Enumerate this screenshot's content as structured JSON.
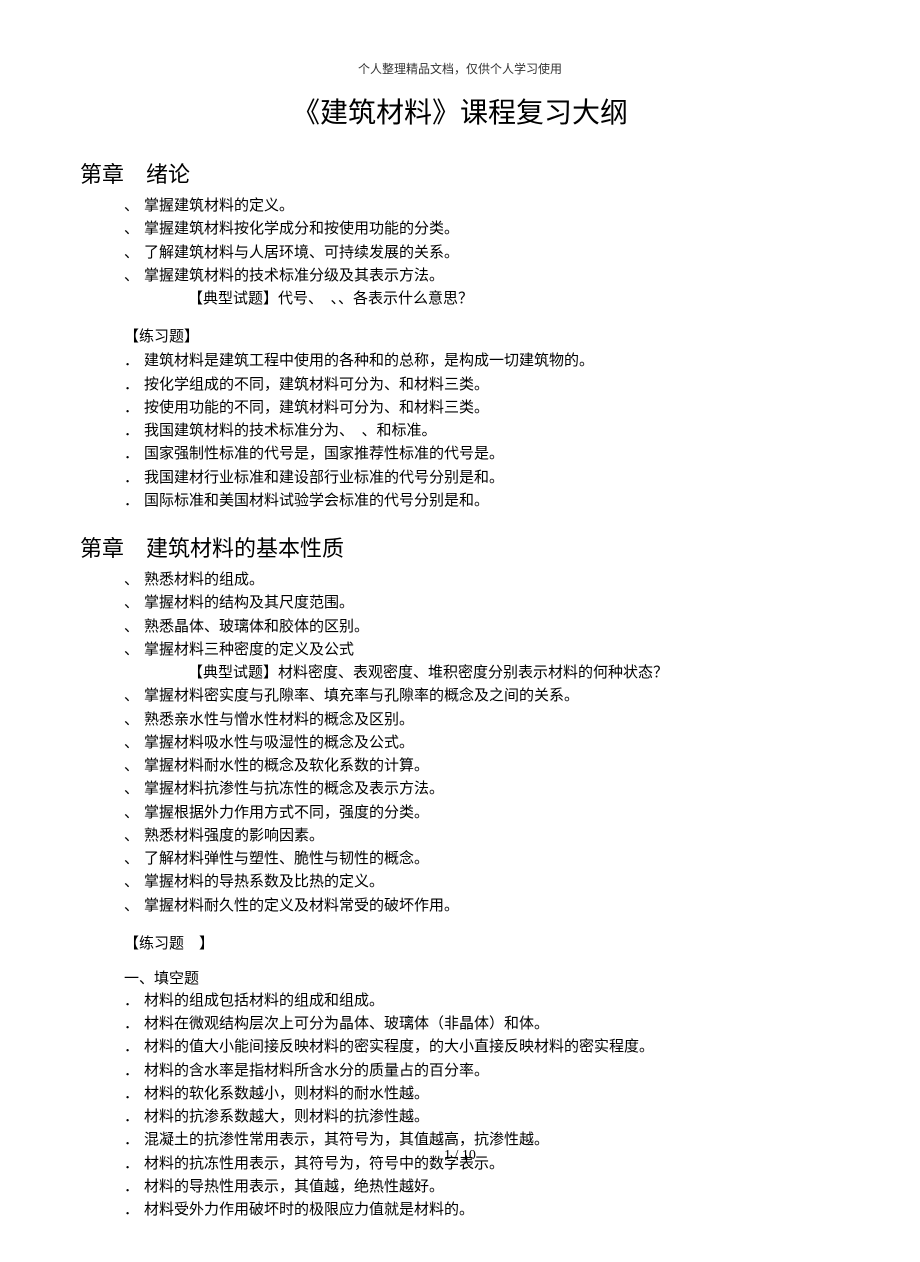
{
  "top_note": "个人整理精品文档，仅供个人学习使用",
  "doc_title": "《建筑材料》课程复习大纲",
  "chapter1": {
    "title": "第章　绪论",
    "points": [
      "掌握建筑材料的定义。",
      "掌握建筑材料按化学成分和按使用功能的分类。",
      "了解建筑材料与人居环境、可持续发展的关系。",
      "掌握建筑材料的技术标准分级及其表示方法。"
    ],
    "typical": "【典型试题】代号、　、、各表示什么意思？",
    "exercise_label": "【练习题】",
    "exercises": [
      "建筑材料是建筑工程中使用的各种和的总称，是构成一切建筑物的。",
      "按化学组成的不同，建筑材料可分为、和材料三类。",
      "按使用功能的不同，建筑材料可分为、和材料三类。",
      "我国建筑材料的技术标准分为、　、和标准。",
      "国家强制性标准的代号是，国家推荐性标准的代号是。",
      "我国建材行业标准和建设部行业标准的代号分别是和。",
      "国际标准和美国材料试验学会标准的代号分别是和。"
    ]
  },
  "chapter2": {
    "title": "第章　建筑材料的基本性质",
    "points_a": [
      "熟悉材料的组成。",
      "掌握材料的结构及其尺度范围。",
      "熟悉晶体、玻璃体和胶体的区别。",
      "掌握材料三种密度的定义及公式"
    ],
    "typical": "【典型试题】材料密度、表观密度、堆积密度分别表示材料的何种状态？",
    "points_b": [
      "掌握材料密实度与孔隙率、填充率与孔隙率的概念及之间的关系。",
      "熟悉亲水性与憎水性材料的概念及区别。",
      "掌握材料吸水性与吸湿性的概念及公式。",
      "掌握材料耐水性的概念及软化系数的计算。",
      "掌握材料抗渗性与抗冻性的概念及表示方法。",
      "掌握根据外力作用方式不同，强度的分类。",
      "熟悉材料强度的影响因素。",
      "了解材料弹性与塑性、脆性与韧性的概念。",
      "掌握材料的导热系数及比热的定义。",
      "掌握材料耐久性的定义及材料常受的破坏作用。"
    ],
    "exercise_label": "【练习题　】",
    "section1_label": "一、填空题",
    "exercises": [
      "材料的组成包括材料的组成和组成。",
      "材料在微观结构层次上可分为晶体、玻璃体（非晶体）和体。",
      "材料的值大小能间接反映材料的密实程度，的大小直接反映材料的密实程度。",
      "材料的含水率是指材料所含水分的质量占的百分率。",
      "材料的软化系数越小，则材料的耐水性越。",
      "材料的抗渗系数越大，则材料的抗渗性越。",
      "混凝土的抗渗性常用表示，其符号为，其值越高，抗渗性越。",
      "材料的抗冻性用表示，其符号为，符号中的数字表示。",
      "材料的导热性用表示，其值越，绝热性越好。",
      "材料受外力作用破坏时的极限应力值就是材料的。"
    ]
  },
  "footer": "1 / 10"
}
